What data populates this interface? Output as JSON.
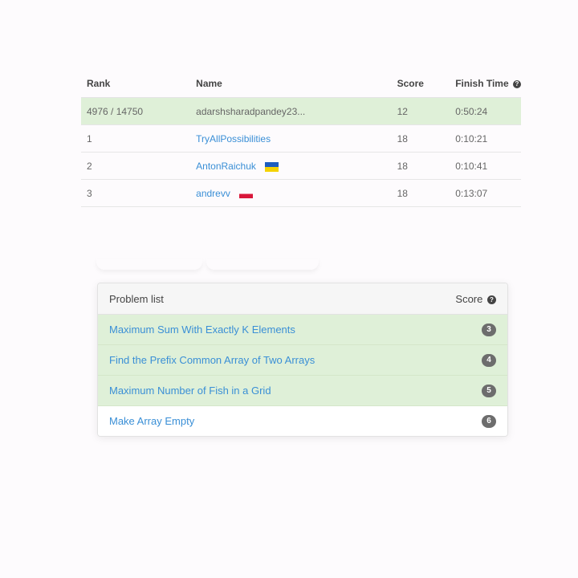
{
  "ranking": {
    "headers": {
      "rank": "Rank",
      "name": "Name",
      "score": "Score",
      "finish_time": "Finish Time"
    },
    "rows": [
      {
        "rank": "4976 / 14750",
        "name": "adarshsharadpandey23...",
        "score": "12",
        "finish_time": "0:50:24",
        "highlighted": true,
        "flag": ""
      },
      {
        "rank": "1",
        "name": "TryAllPossibilities",
        "score": "18",
        "finish_time": "0:10:21",
        "flag": ""
      },
      {
        "rank": "2",
        "name": "AntonRaichuk",
        "score": "18",
        "finish_time": "0:10:41",
        "flag": "ukraine-flag"
      },
      {
        "rank": "3",
        "name": "andrevv",
        "score": "18",
        "finish_time": "0:13:07",
        "flag": "poland-flag"
      }
    ],
    "help_glyph": "?"
  },
  "problem_list": {
    "title": "Problem list",
    "score_label": "Score",
    "help_glyph": "?",
    "problems": [
      {
        "title": "Maximum Sum With Exactly K Elements",
        "score": "3",
        "solved": true
      },
      {
        "title": "Find the Prefix Common Array of Two Arrays",
        "score": "4",
        "solved": true
      },
      {
        "title": "Maximum Number of Fish in a Grid",
        "score": "5",
        "solved": true
      },
      {
        "title": "Make Array Empty",
        "score": "6",
        "solved": false
      }
    ]
  },
  "colors": {
    "link": "#3a8fd6",
    "solved_row": "#dff0d8",
    "badge": "#6d6d6d"
  }
}
